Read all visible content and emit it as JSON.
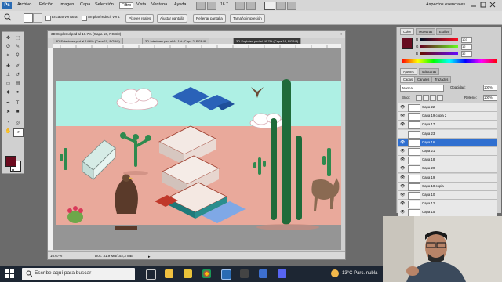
{
  "app": {
    "logo": "Ps",
    "menu": [
      "Archivo",
      "Edición",
      "Imagen",
      "Capa",
      "Selección",
      "Filtro",
      "Vista",
      "Ventana",
      "Ayuda"
    ],
    "zoom": "16.7",
    "workspace": "Aspectos esenciales"
  },
  "options_bar": {
    "encajar": "Encajar ventana",
    "ampliar": "Ampliar/reducir vent.",
    "pixeles_reales": "Píxeles reales",
    "ajustar_pantalla": "Ajustar pantalla",
    "rellenar_pantalla": "Rellenar pantalla",
    "tamano_impresion": "Tamaño impresión"
  },
  "document": {
    "title": "3D-Exploted.psd al 16.7% (Capa 16, RGB/8)",
    "tabs": [
      "3D-Exteriores.psd al 14.6% (Capa 15, RGB/8)",
      "3D-Interiores.psd al 44.1% (Capa 2, RGB/8)",
      "3D-Exploted.psd al 16.7% (Capa 16, RGB/8)"
    ],
    "zoom_status": "16.67%",
    "doc_info": "Doc: 31.9 MB/152,3 MB"
  },
  "panels": {
    "color_tabs": [
      "Color",
      "Muestras",
      "Estilos"
    ],
    "rgb_labels": [
      "R",
      "G",
      "B"
    ],
    "rgb_values": [
      "103",
      "12",
      "32"
    ],
    "adjust_tabs": [
      "Ajustes",
      "Máscaras"
    ],
    "layer_tabs": [
      "Capas",
      "Canales",
      "Trazados"
    ],
    "blend_mode": "Normal",
    "opacity_label": "Opacidad:",
    "opacity": "100%",
    "lock_label": "Bloq.:",
    "fill_label": "Relleno:",
    "fill": "100%",
    "layers": [
      {
        "name": "Capa 22",
        "visible": true
      },
      {
        "name": "Capa 19 copia 2",
        "visible": true
      },
      {
        "name": "Capa 17",
        "visible": true
      },
      {
        "name": "Capa 23",
        "visible": false
      },
      {
        "name": "Capa 16",
        "visible": true,
        "selected": true
      },
      {
        "name": "Capa 21",
        "visible": true
      },
      {
        "name": "Capa 18",
        "visible": true
      },
      {
        "name": "Capa 20",
        "visible": true
      },
      {
        "name": "Capa 19",
        "visible": true
      },
      {
        "name": "Capa 18 copia",
        "visible": true
      },
      {
        "name": "Capa 10",
        "visible": true
      },
      {
        "name": "Capa 12",
        "visible": true
      },
      {
        "name": "Capa 15",
        "visible": true
      }
    ]
  },
  "taskbar": {
    "search_placeholder": "Escribe aquí para buscar",
    "weather": "13°C  Parc. nubla"
  },
  "colors": {
    "foreground": "#670c20",
    "sky": "#aef0e4",
    "ground": "#e9a99b",
    "selected_layer": "#2f6fd0"
  }
}
